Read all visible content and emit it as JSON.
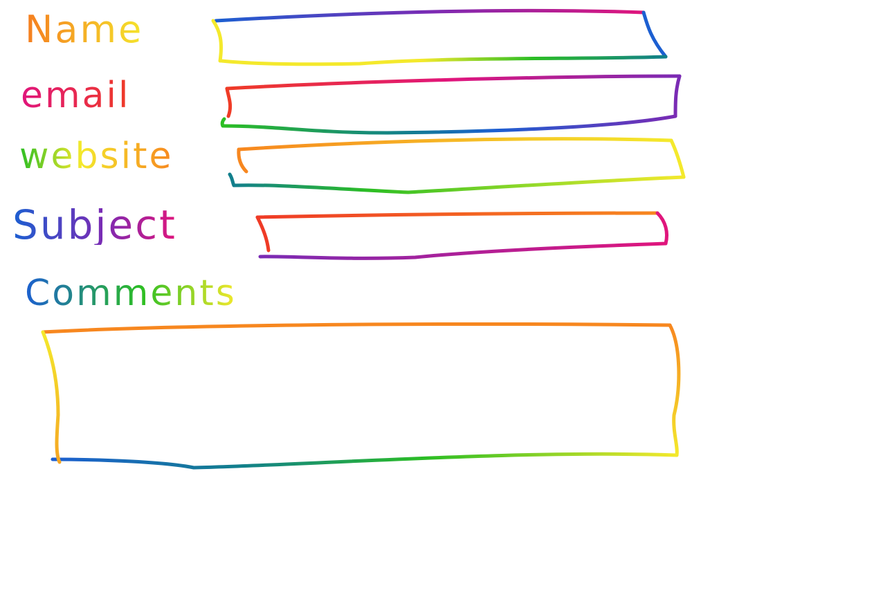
{
  "form": {
    "name_label": "Name",
    "email_label": "email",
    "website_label": "website",
    "subject_label": "Subject",
    "comments_label": "Comments",
    "name_value": "",
    "email_value": "",
    "website_value": "",
    "subject_value": "",
    "comments_value": ""
  },
  "colors": {
    "red": "#ef3b26",
    "orange": "#f7871f",
    "yellow": "#f4e92c",
    "green": "#2cbe24",
    "teal": "#127f8c",
    "blue": "#1c5fd1",
    "purple": "#7a2bb4",
    "magenta": "#e0157c"
  }
}
